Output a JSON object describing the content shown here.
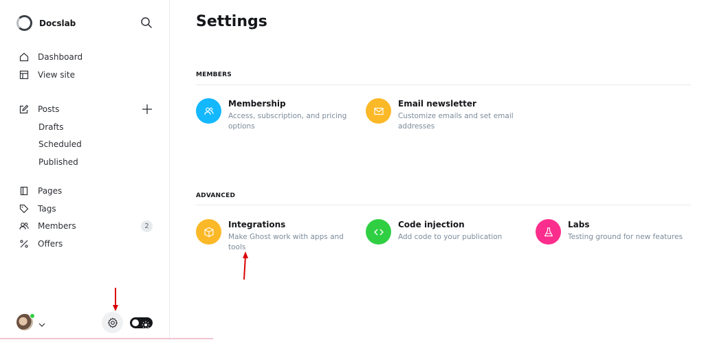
{
  "brand": {
    "name": "Docslab"
  },
  "nav": {
    "dashboard": "Dashboard",
    "view_site": "View site",
    "posts": "Posts",
    "drafts": "Drafts",
    "scheduled": "Scheduled",
    "published": "Published",
    "pages": "Pages",
    "tags": "Tags",
    "members": "Members",
    "members_count": "2",
    "offers": "Offers"
  },
  "main": {
    "title": "Settings",
    "sections": [
      {
        "label": "MEMBERS",
        "cards": [
          {
            "title": "Membership",
            "desc": "Access, subscription, and pricing options",
            "icon": "members-icon",
            "color": "#14b8ff"
          },
          {
            "title": "Email newsletter",
            "desc": "Customize emails and set email addresses",
            "icon": "envelope-icon",
            "color": "#fbb827"
          }
        ]
      },
      {
        "label": "ADVANCED",
        "cards": [
          {
            "title": "Integrations",
            "desc": "Make Ghost work with apps and tools",
            "icon": "cube-icon",
            "color": "#fbb827"
          },
          {
            "title": "Code injection",
            "desc": "Add code to your publication",
            "icon": "code-icon",
            "color": "#30cf43"
          },
          {
            "title": "Labs",
            "desc": "Testing ground for new features",
            "icon": "flask-icon",
            "color": "#fb2d8d"
          }
        ]
      }
    ]
  },
  "colors": {
    "accent_arrow": "#d90000"
  }
}
